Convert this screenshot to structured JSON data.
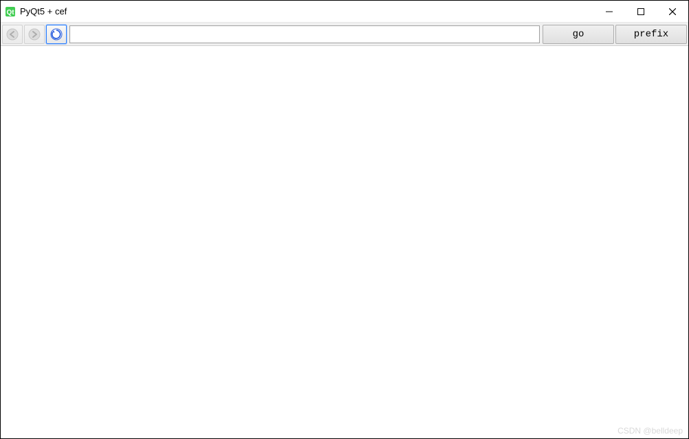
{
  "window": {
    "title": "PyQt5 + cef"
  },
  "toolbar": {
    "url_value": "",
    "go_label": "go",
    "prefix_label": "prefix"
  },
  "watermark": "CSDN @belldeep"
}
